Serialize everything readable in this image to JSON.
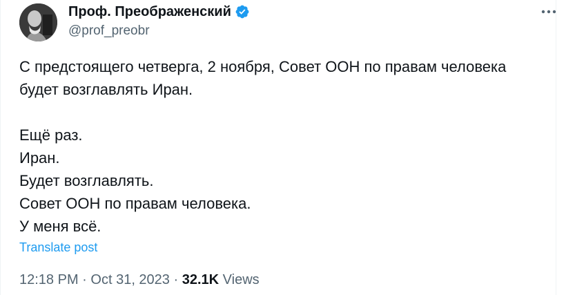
{
  "author": {
    "name": "Проф. Преображенский",
    "handle": "@prof_preobr",
    "verified": true,
    "avatar_icon": "portrait-avatar"
  },
  "post": {
    "lines": [
      "С предстоящего четверга, 2 ноября, Совет ООН по правам человека",
      "будет возглавлять Иран.",
      "",
      "Ещё раз.",
      "Иран.",
      "Будет возглавлять.",
      "Совет ООН по правам человека.",
      "У меня всё."
    ],
    "translate_label": "Translate post"
  },
  "meta": {
    "time": "12:18 PM",
    "separator": "·",
    "date": "Oct 31, 2023",
    "views_count": "32.1K",
    "views_label": "Views"
  },
  "colors": {
    "link": "#1d9bf0",
    "secondary_text": "#536471",
    "primary_text": "#0f1419",
    "verified_badge": "#1d9bf0"
  },
  "icons": {
    "more": "more-horizontal-icon",
    "verified": "verified-badge-icon"
  }
}
